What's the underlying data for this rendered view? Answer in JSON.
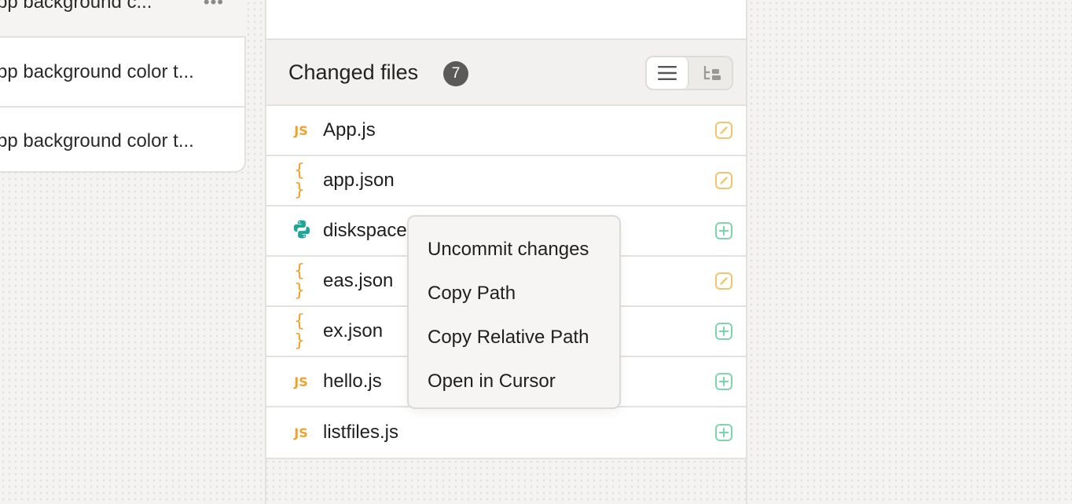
{
  "commits": {
    "items": [
      {
        "label": "pp background c...",
        "more": "•••"
      },
      {
        "label": "pp background color t..."
      },
      {
        "label": "pp background color t..."
      }
    ]
  },
  "changed_files": {
    "title": "Changed files",
    "count": "7",
    "view_modes": [
      "list-view-icon",
      "tree-view-icon"
    ],
    "files": [
      {
        "name": "App.js",
        "type_icon": "JS",
        "kind": "js",
        "status": "modified"
      },
      {
        "name": "app.json",
        "type_icon": "{ }",
        "kind": "json",
        "status": "modified"
      },
      {
        "name": "diskspace",
        "type_icon": "python-icon",
        "kind": "py",
        "status": "added"
      },
      {
        "name": "eas.json",
        "type_icon": "{ }",
        "kind": "json",
        "status": "modified"
      },
      {
        "name": "ex.json",
        "type_icon": "{ }",
        "kind": "json",
        "status": "added"
      },
      {
        "name": "hello.js",
        "type_icon": "JS",
        "kind": "js",
        "status": "added"
      },
      {
        "name": "listfiles.js",
        "type_icon": "JS",
        "kind": "js",
        "status": "added"
      }
    ]
  },
  "context_menu": {
    "items": [
      "Uncommit changes",
      "Copy Path",
      "Copy Relative Path",
      "Open in Cursor"
    ]
  },
  "colors": {
    "modified": "#f2c46b",
    "added": "#7fd4b0",
    "js_icon": "#f0a12a",
    "python": "#1fa59a"
  }
}
